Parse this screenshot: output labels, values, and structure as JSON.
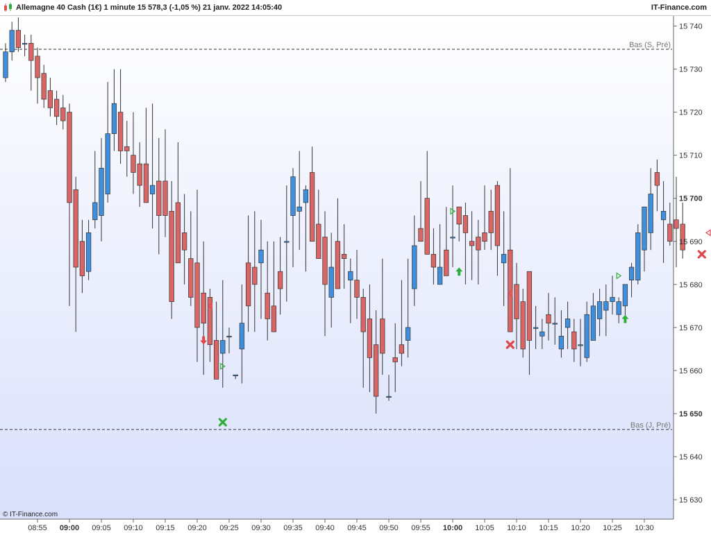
{
  "header": {
    "title": "Allemagne 40 Cash (1€) 1 minute 15 578,3 (-1,05 %) 21 janv. 2022 14:05:40",
    "brand": "IT-Finance.com"
  },
  "footer": {
    "copyright": "© IT-Finance.com"
  },
  "colors": {
    "up": "#3f8fdc",
    "down": "#d96565",
    "signal_green": "#2fae3a",
    "signal_red": "#e0474c"
  },
  "chart_data": {
    "type": "candlestick",
    "ylim": [
      15625.5,
      15742.5
    ],
    "y_ticks": [
      {
        "value": 15740,
        "label": "15 740",
        "bold": false
      },
      {
        "value": 15730,
        "label": "15 730",
        "bold": false
      },
      {
        "value": 15720,
        "label": "15 720",
        "bold": false
      },
      {
        "value": 15710,
        "label": "15 710",
        "bold": false
      },
      {
        "value": 15700,
        "label": "15 700",
        "bold": true
      },
      {
        "value": 15690,
        "label": "15 690",
        "bold": false
      },
      {
        "value": 15680,
        "label": "15 680",
        "bold": false
      },
      {
        "value": 15670,
        "label": "15 670",
        "bold": false
      },
      {
        "value": 15660,
        "label": "15 660",
        "bold": false
      },
      {
        "value": 15650,
        "label": "15 650",
        "bold": true
      },
      {
        "value": 15640,
        "label": "15 640",
        "bold": false
      },
      {
        "value": 15630,
        "label": "15 630",
        "bold": false
      }
    ],
    "x_ticks": [
      {
        "index": 5,
        "label": "08:55",
        "bold": false
      },
      {
        "index": 10,
        "label": "09:00",
        "bold": true
      },
      {
        "index": 15,
        "label": "09:05",
        "bold": false
      },
      {
        "index": 20,
        "label": "09:10",
        "bold": false
      },
      {
        "index": 25,
        "label": "09:15",
        "bold": false
      },
      {
        "index": 30,
        "label": "09:20",
        "bold": false
      },
      {
        "index": 35,
        "label": "09:25",
        "bold": false
      },
      {
        "index": 40,
        "label": "09:30",
        "bold": false
      },
      {
        "index": 45,
        "label": "09:35",
        "bold": false
      },
      {
        "index": 50,
        "label": "09:40",
        "bold": false
      },
      {
        "index": 55,
        "label": "09:45",
        "bold": false
      },
      {
        "index": 60,
        "label": "09:50",
        "bold": false
      },
      {
        "index": 65,
        "label": "09:55",
        "bold": false
      },
      {
        "index": 70,
        "label": "10:00",
        "bold": true
      },
      {
        "index": 75,
        "label": "10:05",
        "bold": false
      },
      {
        "index": 80,
        "label": "10:10",
        "bold": false
      },
      {
        "index": 85,
        "label": "10:15",
        "bold": false
      },
      {
        "index": 90,
        "label": "10:20",
        "bold": false
      },
      {
        "index": 95,
        "label": "10:25",
        "bold": false
      },
      {
        "index": 100,
        "label": "10:30",
        "bold": false
      }
    ],
    "levels": [
      {
        "value": 15734.6,
        "label": "Bas (S, Pré)"
      },
      {
        "value": 15646.3,
        "label": "Bas (J, Pré)"
      }
    ],
    "candles": [
      [
        15728,
        15736,
        15727,
        15734
      ],
      [
        15734,
        15741,
        15732,
        15739
      ],
      [
        15739,
        15742,
        15734,
        15735
      ],
      [
        15736,
        15738,
        15733,
        15736
      ],
      [
        15736,
        15738,
        15725,
        15732
      ],
      [
        15733,
        15735,
        15722,
        15728
      ],
      [
        15729,
        15731,
        15721,
        15723
      ],
      [
        15725,
        15728,
        15719,
        15721
      ],
      [
        15723,
        15725,
        15717,
        15719
      ],
      [
        15721,
        15724,
        15716,
        15718
      ],
      [
        15720,
        15722,
        15675,
        15699
      ],
      [
        15702,
        15705,
        15669,
        15684
      ],
      [
        15690,
        15695,
        15678,
        15682
      ],
      [
        15683,
        15695,
        15681,
        15692
      ],
      [
        15695,
        15711,
        15693,
        15699
      ],
      [
        15696,
        15714,
        15690,
        15707
      ],
      [
        15701,
        15727,
        15699,
        15715
      ],
      [
        15715,
        15730,
        15711,
        15722
      ],
      [
        15720,
        15730,
        15708,
        15711
      ],
      [
        15712,
        15718,
        15705,
        15711
      ],
      [
        15710,
        15720,
        15701,
        15706
      ],
      [
        15708,
        15713,
        15698,
        15703
      ],
      [
        15708,
        15721,
        15705,
        15699
      ],
      [
        15701,
        15722,
        15693,
        15703
      ],
      [
        15704,
        15714,
        15687,
        15696
      ],
      [
        15704,
        15716,
        15691,
        15696
      ],
      [
        15697,
        15704,
        15672,
        15676
      ],
      [
        15699,
        15713,
        15688,
        15685
      ],
      [
        15692,
        15701,
        15680,
        15688
      ],
      [
        15686,
        15697,
        15675,
        15677
      ],
      [
        15685,
        15702,
        15662,
        15670
      ],
      [
        15678,
        15690,
        15659,
        15671
      ],
      [
        15677,
        15679,
        15662,
        15666
      ],
      [
        15667,
        15676,
        15658,
        15658
      ],
      [
        15664,
        15681,
        15656,
        15667
      ],
      [
        15668,
        15670,
        15664,
        15668
      ],
      [
        15659,
        15659,
        15658,
        15659
      ],
      [
        15665,
        15680,
        15657,
        15671
      ],
      [
        15685,
        15696,
        15669,
        15675
      ],
      [
        15684,
        15697,
        15669,
        15680
      ],
      [
        15685,
        15695,
        15672,
        15688
      ],
      [
        15678,
        15690,
        15667,
        15672
      ],
      [
        15675,
        15690,
        15670,
        15669
      ],
      [
        15683,
        15691,
        15673,
        15679
      ],
      [
        15690,
        15703,
        15676,
        15690
      ],
      [
        15696,
        15707,
        15684,
        15705
      ],
      [
        15697,
        15711,
        15688,
        15698
      ],
      [
        15699,
        15703,
        15683,
        15702
      ],
      [
        15706,
        15712,
        15694,
        15690
      ],
      [
        15694,
        15702,
        15687,
        15686
      ],
      [
        15691,
        15697,
        15668,
        15680
      ],
      [
        15677,
        15692,
        15670,
        15684
      ],
      [
        15690,
        15700,
        15680,
        15679
      ],
      [
        15687,
        15694,
        15679,
        15686
      ],
      [
        15681,
        15686,
        15671,
        15683
      ],
      [
        15681,
        15688,
        15672,
        15677
      ],
      [
        15677,
        15679,
        15656,
        15669
      ],
      [
        15672,
        15680,
        15655,
        15663
      ],
      [
        15666,
        15674,
        15650,
        15654
      ],
      [
        15672,
        15686,
        15659,
        15664
      ],
      [
        15654,
        15659,
        15653,
        15654
      ],
      [
        15663,
        15671,
        15655,
        15662
      ],
      [
        15666,
        15681,
        15661,
        15664
      ],
      [
        15667,
        15686,
        15663,
        15670
      ],
      [
        15679,
        15696,
        15675,
        15689
      ],
      [
        15693,
        15704,
        15691,
        15690
      ],
      [
        15700,
        15711,
        15694,
        15687
      ],
      [
        15687,
        15693,
        15680,
        15684
      ],
      [
        15680,
        15694,
        15680,
        15684
      ],
      [
        15688,
        15698,
        15684,
        15682
      ],
      [
        15691,
        15703,
        15684,
        15691
      ],
      [
        15698,
        15698,
        15690,
        15694
      ],
      [
        15696,
        15699,
        15680,
        15692
      ],
      [
        15690,
        15697,
        15681,
        15689
      ],
      [
        15691,
        15695,
        15680,
        15688
      ],
      [
        15692,
        15703,
        15688,
        15690
      ],
      [
        15697,
        15702,
        15688,
        15692
      ],
      [
        15703,
        15704,
        15682,
        15689
      ],
      [
        15685,
        15697,
        15675,
        15687
      ],
      [
        15688,
        15707,
        15671,
        15669
      ],
      [
        15680,
        15685,
        15665,
        15672
      ],
      [
        15676,
        15679,
        15663,
        15665
      ],
      [
        15683,
        15680,
        15659,
        15667
      ],
      [
        15670,
        15675,
        15665,
        15670
      ],
      [
        15668,
        15672,
        15665,
        15669
      ],
      [
        15673,
        15678,
        15667,
        15671
      ],
      [
        15671,
        15677,
        15666,
        15671
      ],
      [
        15665,
        15674,
        15663,
        15668
      ],
      [
        15670,
        15676,
        15665,
        15672
      ],
      [
        15669,
        15672,
        15662,
        15665
      ],
      [
        15666,
        15672,
        15661,
        15666
      ],
      [
        15663,
        15676,
        15662,
        15673
      ],
      [
        15667,
        15678,
        15667,
        15675
      ],
      [
        15672,
        15679,
        15668,
        15676
      ],
      [
        15674,
        15680,
        15668,
        15676
      ],
      [
        15676,
        15682,
        15673,
        15677
      ],
      [
        15673,
        15677,
        15671,
        15676
      ],
      [
        15675,
        15679,
        15672,
        15680
      ],
      [
        15681,
        15685,
        15677,
        15684
      ],
      [
        15681,
        15694,
        15680,
        15692
      ],
      [
        15688,
        15697,
        15683,
        15698
      ],
      [
        15692,
        15707,
        15688,
        15701
      ],
      [
        15706,
        15709,
        15697,
        15703
      ],
      [
        15695,
        15704,
        15685,
        15697
      ],
      [
        15694,
        15699,
        15689,
        15690
      ],
      [
        15695,
        15705,
        15684,
        15693
      ],
      [
        15694,
        15699,
        15686,
        15688
      ]
    ],
    "markers": [
      {
        "type": "arrow-down",
        "color": "red",
        "index": 31,
        "value": 15667
      },
      {
        "type": "tri-left",
        "color": "red",
        "index": 32,
        "value": 15675
      },
      {
        "type": "tri-right",
        "color": "green",
        "index": 34,
        "value": 15661
      },
      {
        "type": "cross",
        "color": "green",
        "index": 34,
        "value": 15648
      },
      {
        "type": "tri-right",
        "color": "green",
        "index": 70,
        "value": 15697
      },
      {
        "type": "arrow-up",
        "color": "green",
        "index": 71,
        "value": 15683
      },
      {
        "type": "cross",
        "color": "red",
        "index": 79,
        "value": 15666
      },
      {
        "type": "tri-left",
        "color": "red",
        "index": 79,
        "value": 15678
      },
      {
        "type": "tri-right",
        "color": "green",
        "index": 96,
        "value": 15682
      },
      {
        "type": "arrow-up",
        "color": "green",
        "index": 97,
        "value": 15672
      },
      {
        "type": "cross",
        "color": "red",
        "index": 109,
        "value": 15687
      },
      {
        "type": "tri-left",
        "color": "red",
        "index": 110,
        "value": 15692
      }
    ]
  }
}
